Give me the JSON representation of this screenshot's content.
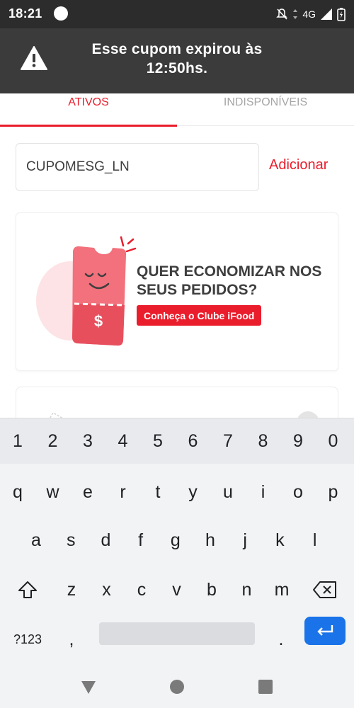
{
  "status_bar": {
    "time": "18:21",
    "network": "4G"
  },
  "toast": {
    "message": "Esse cupom expirou às 12:50hs.",
    "icon": "warning-icon"
  },
  "tabs": [
    {
      "label": "ATIVOS",
      "active": true
    },
    {
      "label": "INDISPONÍVEIS",
      "active": false
    }
  ],
  "coupon": {
    "value": "CUPOMESG_LN",
    "add_label": "Adicionar"
  },
  "banner": {
    "headline": "QUER ECONOMIZAR NOS SEUS PEDIDOS?",
    "cta_label": "Conheça o Clube iFood",
    "ticket_symbol": "$"
  },
  "keyboard": {
    "numbers": [
      "1",
      "2",
      "3",
      "4",
      "5",
      "6",
      "7",
      "8",
      "9",
      "0"
    ],
    "row1": [
      "q",
      "w",
      "e",
      "r",
      "t",
      "y",
      "u",
      "i",
      "o",
      "p"
    ],
    "row2": [
      "a",
      "s",
      "d",
      "f",
      "g",
      "h",
      "j",
      "k",
      "l"
    ],
    "row3": [
      "z",
      "x",
      "c",
      "v",
      "b",
      "n",
      "m"
    ],
    "symbols_label": "?123",
    "comma": ",",
    "period": "."
  },
  "colors": {
    "brand": "#ea1d2c",
    "enter": "#1a73e8"
  }
}
